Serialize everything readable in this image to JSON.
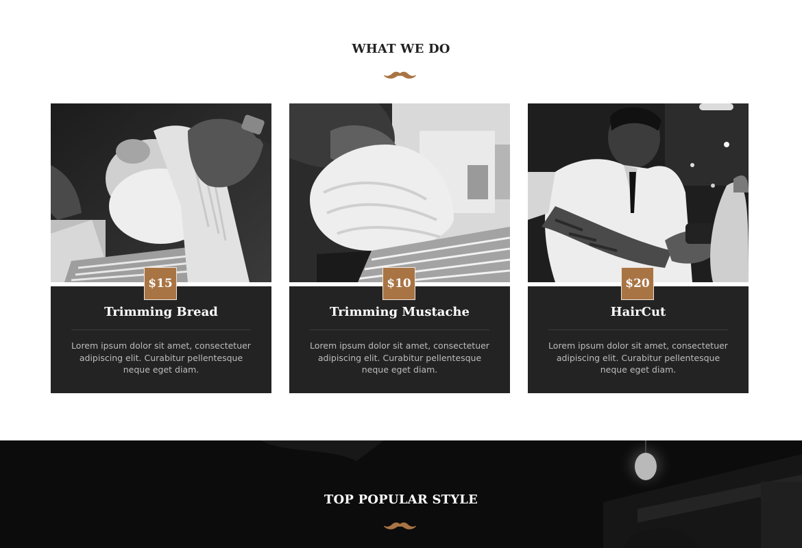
{
  "services": {
    "title": "WHAT WE DO",
    "items": [
      {
        "price": "$15",
        "title": "Trimming Bread",
        "description": "Lorem ipsum dolor sit amet, consectetuer adipiscing elit. Curabitur pellentesque neque eget diam.",
        "image": "barber-shave-photo"
      },
      {
        "price": "$10",
        "title": "Trimming Mustache",
        "description": "Lorem ipsum dolor sit amet, consectetuer adipiscing elit. Curabitur pellentesque neque eget diam.",
        "image": "towel-wrap-photo"
      },
      {
        "price": "$20",
        "title": "HairCut",
        "description": "Lorem ipsum dolor sit amet, consectetuer adipiscing elit. Curabitur pellentesque neque eget diam.",
        "image": "haircut-clipper-photo"
      }
    ]
  },
  "popular": {
    "title": "TOP POPULAR STYLE"
  },
  "colors": {
    "accent": "#a97444",
    "card_bg": "#232323",
    "dark_section_bg": "#0c0c0c",
    "title_dark": "#222222"
  },
  "icons": {
    "divider": "mustache-icon"
  }
}
